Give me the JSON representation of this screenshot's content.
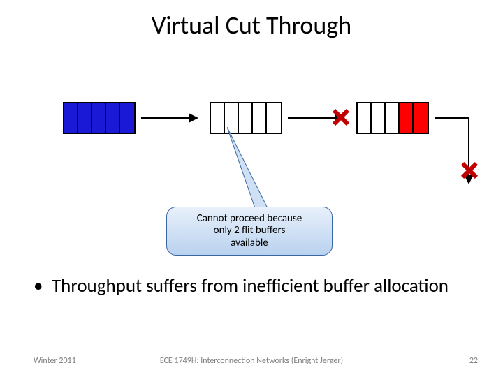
{
  "title": "Virtual Cut Through",
  "buffers": {
    "buf1": {
      "cells": [
        "blue",
        "blue",
        "blue",
        "blue",
        "blue"
      ]
    },
    "buf2": {
      "cells": [
        "empty",
        "empty",
        "empty",
        "empty",
        "empty"
      ]
    },
    "buf3": {
      "cells": [
        "empty",
        "empty",
        "empty",
        "red",
        "red"
      ]
    }
  },
  "callout": {
    "line1": "Cannot proceed because",
    "line2": "only 2 flit buffers",
    "line3": "available"
  },
  "bullet": {
    "marker": "•",
    "text": "Throughput suffers from inefficient buffer allocation"
  },
  "footer": {
    "left": "Winter 2011",
    "center": "ECE 1749H: Interconnection Networks (Enright Jerger)",
    "right": "22"
  }
}
